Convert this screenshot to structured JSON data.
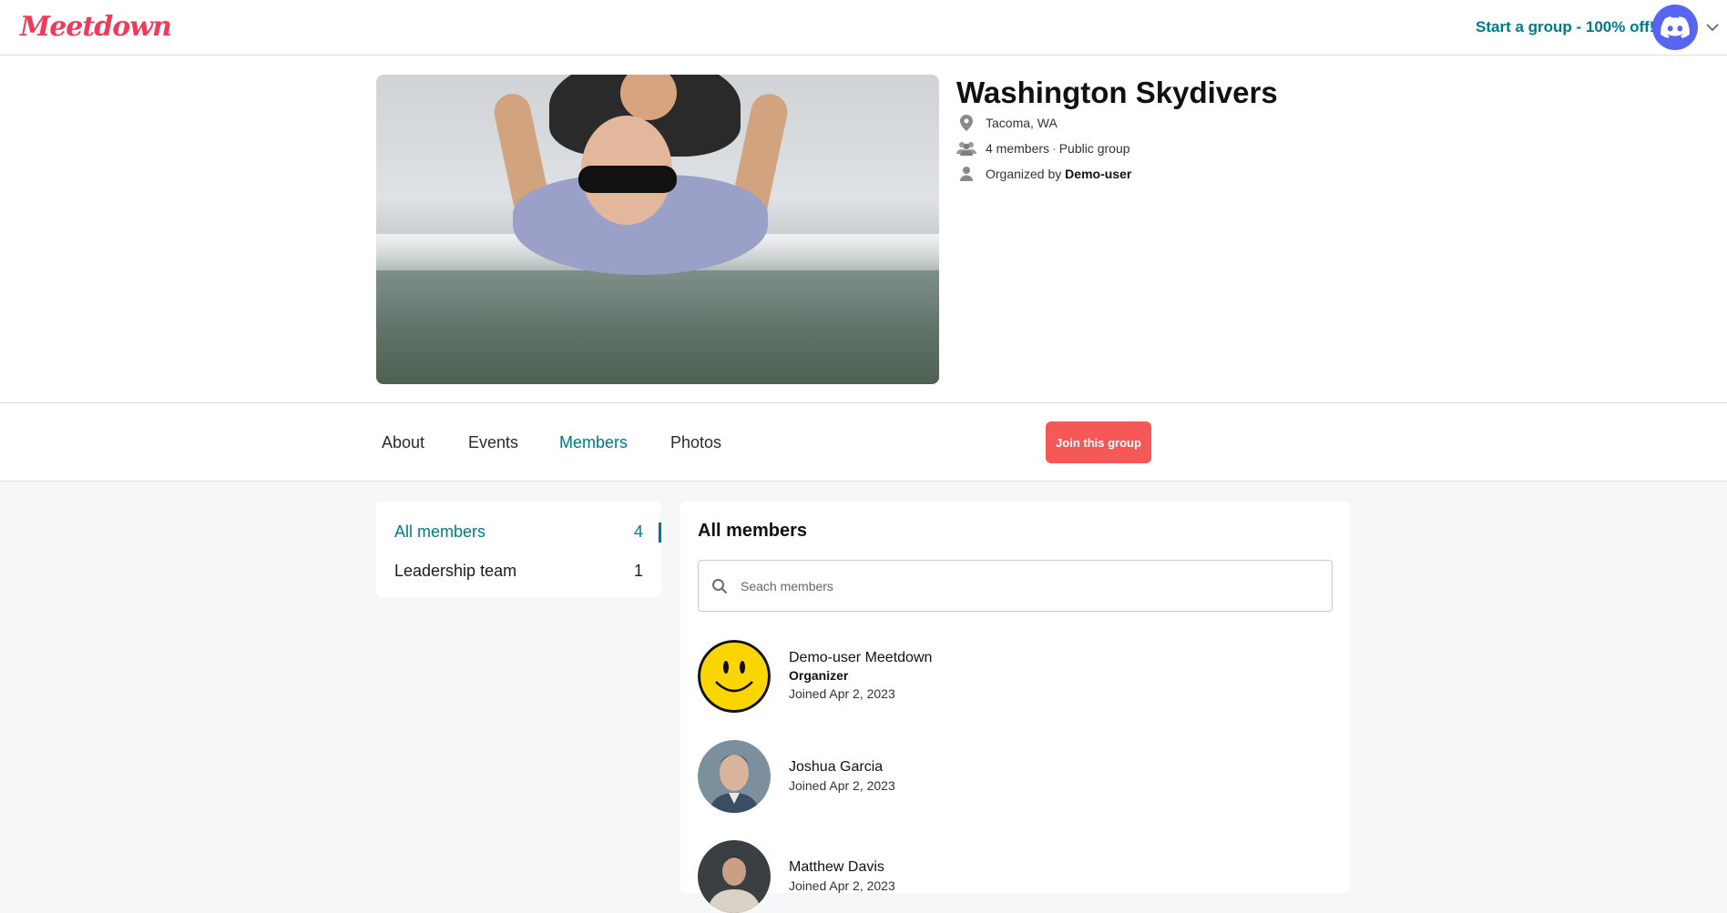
{
  "header": {
    "logo": "Meetdown",
    "start_group_link": "Start a group - 100% off!",
    "user_avatar_icon": "discord-icon",
    "menu_icon": "chevron-down-icon"
  },
  "group": {
    "title": "Washington Skydivers",
    "location": "Tacoma, WA",
    "members_count_text": "4 members",
    "dot": "·",
    "visibility": "Public group",
    "organized_by_label": "Organized by",
    "organizer": "Demo-user"
  },
  "tabs": [
    {
      "label": "About"
    },
    {
      "label": "Events"
    },
    {
      "label": "Members"
    },
    {
      "label": "Photos"
    }
  ],
  "join_button": "Join this group",
  "filters": [
    {
      "label": "All members",
      "count": "4"
    },
    {
      "label": "Leadership team",
      "count": "1"
    }
  ],
  "members_panel": {
    "title": "All members",
    "search_placeholder": "Seach members",
    "members": [
      {
        "name": "Demo-user Meetdown",
        "role": "Organizer",
        "joined": "Joined Apr 2, 2023"
      },
      {
        "name": "Joshua Garcia",
        "joined": "Joined Apr 2, 2023"
      },
      {
        "name": "Matthew Davis",
        "joined": "Joined Apr 2, 2023"
      }
    ]
  },
  "colors": {
    "brand": "#f13a59",
    "accent": "#00798a",
    "join_button": "#f65858",
    "discord": "#5865f2"
  }
}
